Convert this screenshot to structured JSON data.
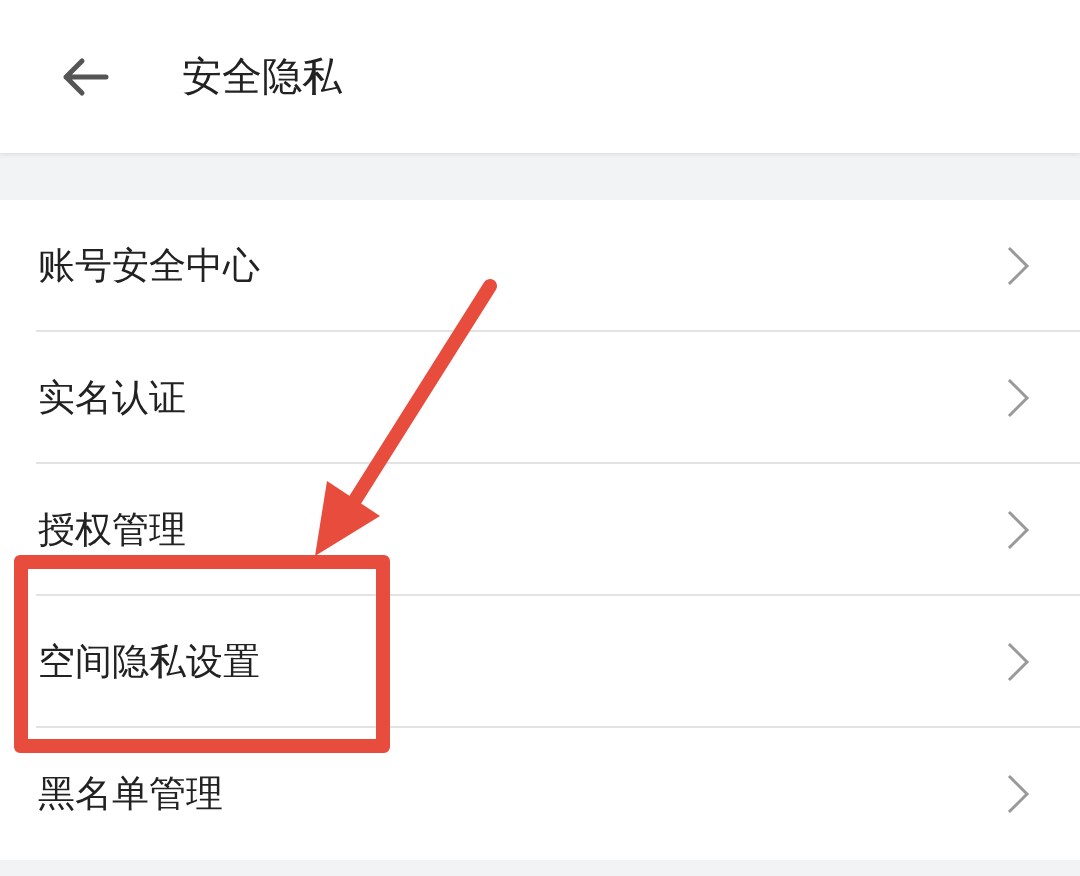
{
  "header": {
    "title": "安全隐私"
  },
  "items": [
    {
      "label": "账号安全中心",
      "highlighted": false
    },
    {
      "label": "实名认证",
      "highlighted": false
    },
    {
      "label": "授权管理",
      "highlighted": false
    },
    {
      "label": "空间隐私设置",
      "highlighted": true
    },
    {
      "label": "黑名单管理",
      "highlighted": false
    }
  ]
}
